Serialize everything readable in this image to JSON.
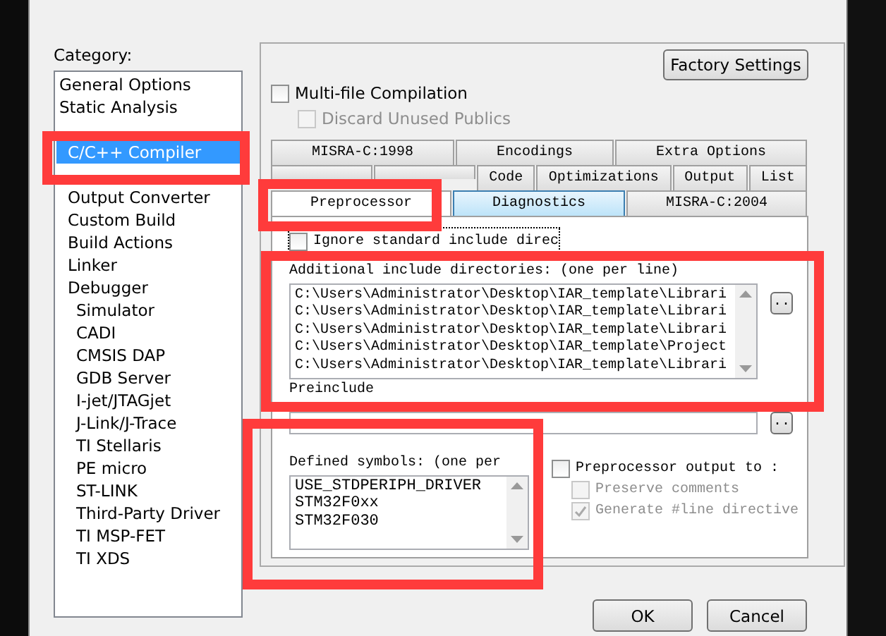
{
  "category": {
    "label": "Category:",
    "items": [
      {
        "label": "General Options",
        "selected": false
      },
      {
        "label": "Static Analysis",
        "selected": false
      },
      {
        "kind": "covered"
      },
      {
        "label": "C/C++ Compiler",
        "selected": true
      },
      {
        "kind": "covered"
      },
      {
        "label": "Output Converter",
        "selected": false
      },
      {
        "label": "Custom Build",
        "selected": false
      },
      {
        "label": "Build Actions",
        "selected": false
      },
      {
        "label": "Linker",
        "selected": false
      },
      {
        "label": "Debugger",
        "selected": false,
        "children": [
          {
            "label": "Simulator",
            "selected": false
          },
          {
            "label": "CADI",
            "selected": false
          },
          {
            "label": "CMSIS DAP",
            "selected": false
          },
          {
            "label": "GDB Server",
            "selected": false
          },
          {
            "label": "I-jet/JTAGjet",
            "selected": false
          },
          {
            "label": "J-Link/J-Trace",
            "selected": false
          },
          {
            "label": "TI Stellaris",
            "selected": false
          },
          {
            "label": "PE micro",
            "selected": false
          },
          {
            "label": "ST-LINK",
            "selected": false
          },
          {
            "label": "Third-Party Driver",
            "selected": false
          },
          {
            "label": "TI MSP-FET",
            "selected": false
          },
          {
            "label": "TI XDS",
            "selected": false
          }
        ]
      }
    ]
  },
  "factory_button": "Factory Settings",
  "multi_file": {
    "label": "Multi-file Compilation",
    "checked": false,
    "disabled": false
  },
  "discard_publics": {
    "label": "Discard Unused Publics",
    "checked": false,
    "disabled": true
  },
  "tab_rows": [
    [
      {
        "label": "MISRA-C:1998",
        "selected": false,
        "hovered": false
      },
      {
        "label": "Encodings",
        "selected": false,
        "hovered": false
      },
      {
        "label": "Extra Options",
        "selected": false,
        "hovered": false
      }
    ],
    [
      {
        "kind": "covered"
      },
      {
        "kind": "covered"
      },
      {
        "label": "Code",
        "selected": false,
        "hovered": false
      },
      {
        "label": "Optimizations",
        "selected": false,
        "hovered": false
      },
      {
        "label": "Output",
        "selected": false,
        "hovered": false
      },
      {
        "label": "List",
        "selected": false,
        "hovered": false
      }
    ],
    [
      {
        "label": "Preprocessor",
        "selected": true,
        "hovered": false
      },
      {
        "label": "Diagnostics",
        "selected": false,
        "hovered": true
      },
      {
        "label": "MISRA-C:2004",
        "selected": false,
        "hovered": false
      }
    ]
  ],
  "ignore_std": {
    "label": "Ignore standard include direc",
    "checked": false,
    "disabled": false
  },
  "include_dirs": {
    "label": "Additional include directories: (one per line)",
    "lines": [
      "C:\\Users\\Administrator\\Desktop\\IAR_template\\Librari",
      "C:\\Users\\Administrator\\Desktop\\IAR_template\\Librari",
      "C:\\Users\\Administrator\\Desktop\\IAR_template\\Librari",
      "C:\\Users\\Administrator\\Desktop\\IAR_template\\Project",
      "C:\\Users\\Administrator\\Desktop\\IAR_template\\Librari"
    ],
    "browse": ".."
  },
  "preinclude": {
    "label": "Preinclude",
    "browse": ".."
  },
  "defined_symbols": {
    "label": "Defined symbols: (one per",
    "lines": [
      "USE_STDPERIPH_DRIVER",
      "STM32F0xx",
      "STM32F030"
    ]
  },
  "pp_output": {
    "label": "Preprocessor output to :",
    "checked": false,
    "disabled": false,
    "children": [
      {
        "label": "Preserve comments",
        "checked": false,
        "disabled": true
      },
      {
        "label": "Generate #line directive",
        "checked": true,
        "disabled": true
      }
    ]
  },
  "buttons": [
    "OK",
    "Cancel"
  ]
}
